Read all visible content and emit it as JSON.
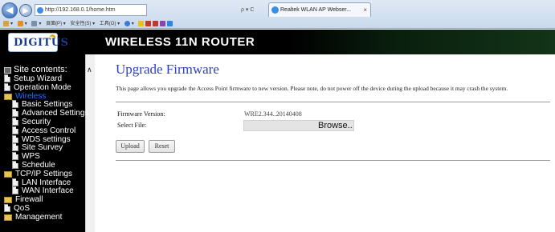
{
  "browser": {
    "back_glyph": "◀",
    "forward_glyph": "▶",
    "address": "http://192.168.0.1/home.htm",
    "address_controls": "ρ ▾ C",
    "tab_title": "Realtek WLAN AP Webser...",
    "tab_close": "×",
    "command_items": [
      "▾",
      "▾",
      "▾",
      "頁面(P) ▾",
      "安全性(S) ▾",
      "工具(O) ▾",
      "▾"
    ]
  },
  "header": {
    "logo": "DIGITUS",
    "title": "WIRELESS 11N ROUTER"
  },
  "sidebar": {
    "heading": "Site contents:",
    "scroll_up": "∧",
    "items": [
      {
        "label": "Setup Wizard",
        "icon": "document-icon",
        "indent": 1
      },
      {
        "label": "Operation Mode",
        "icon": "document-icon",
        "indent": 1
      },
      {
        "label": "Wireless",
        "icon": "folder-icon",
        "indent": 1,
        "active": true
      },
      {
        "label": "Basic Settings",
        "icon": "document-icon",
        "indent": 2
      },
      {
        "label": "Advanced Settings",
        "icon": "document-icon",
        "indent": 2
      },
      {
        "label": "Security",
        "icon": "document-icon",
        "indent": 2
      },
      {
        "label": "Access Control",
        "icon": "document-icon",
        "indent": 2
      },
      {
        "label": "WDS settings",
        "icon": "document-icon",
        "indent": 2
      },
      {
        "label": "Site Survey",
        "icon": "document-icon",
        "indent": 2
      },
      {
        "label": "WPS",
        "icon": "document-icon",
        "indent": 2
      },
      {
        "label": "Schedule",
        "icon": "document-icon",
        "indent": 2
      },
      {
        "label": "TCP/IP Settings",
        "icon": "folder-icon",
        "indent": 1
      },
      {
        "label": "LAN Interface",
        "icon": "document-icon",
        "indent": 2
      },
      {
        "label": "WAN Interface",
        "icon": "document-icon",
        "indent": 2
      },
      {
        "label": "Firewall",
        "icon": "folder-icon",
        "indent": 1
      },
      {
        "label": "QoS",
        "icon": "document-icon",
        "indent": 1
      },
      {
        "label": "Management",
        "icon": "folder-icon",
        "indent": 1
      }
    ]
  },
  "main": {
    "title": "Upgrade Firmware",
    "description": "This page allows you upgrade the Access Point firmware to new version. Please note, do not power off the device during the upload because it may crash the system.",
    "firmware_version_label": "Firmware Version:",
    "firmware_version_value": "WRE2.344..20140408",
    "select_file_label": "Select File:",
    "browse_label": "Browse..",
    "upload_label": "Upload",
    "reset_label": "Reset"
  },
  "colors": {
    "title_blue": "#2b3fbf",
    "active_link": "#1f6fff",
    "header_bg": "#000000"
  }
}
